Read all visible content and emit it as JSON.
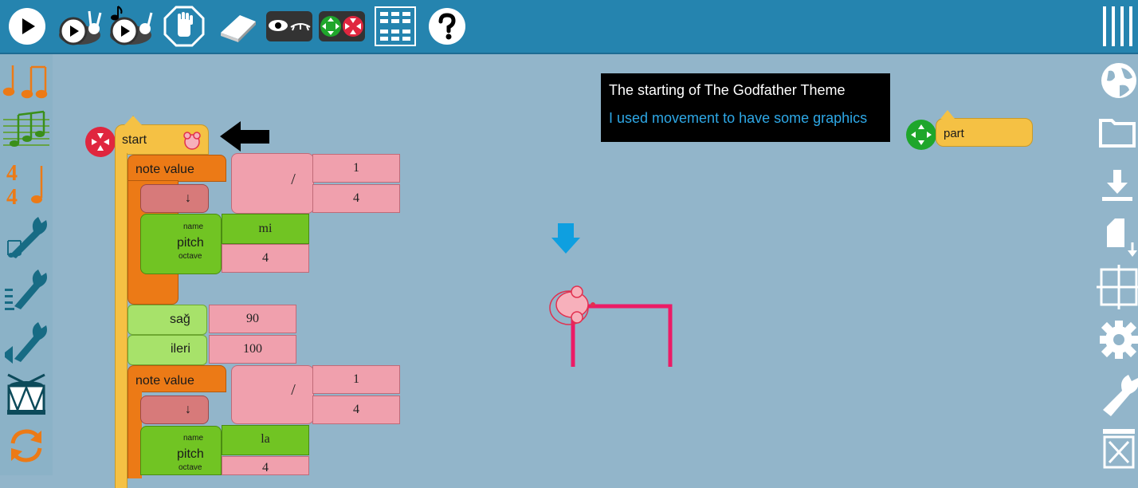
{
  "toolbar": {
    "buttons": [
      {
        "name": "play-button",
        "icon": "play-icon"
      },
      {
        "name": "play-slowly-button",
        "icon": "snail-play-icon"
      },
      {
        "name": "play-music-slowly-button",
        "icon": "snail-music-icon"
      },
      {
        "name": "stop-button",
        "icon": "hand-stop-icon"
      },
      {
        "name": "clear-button",
        "icon": "eraser-icon"
      },
      {
        "name": "hide-blocks-button",
        "icon": "eye-toggle-icon"
      },
      {
        "name": "collapse-expand-button",
        "icon": "collapse-expand-icon"
      },
      {
        "name": "grid-view-button",
        "icon": "grid-icon"
      },
      {
        "name": "help-button",
        "icon": "question-icon"
      }
    ],
    "menu_icon": "hamburger-menu-icon"
  },
  "palette": [
    "rhythm",
    "meter",
    "pitch",
    "tone",
    "ornament",
    "volume",
    "drum",
    "action"
  ],
  "right_tools": [
    "globe-icon",
    "folder-icon",
    "download-icon",
    "new-file-icon",
    "grid-toggle-icon",
    "gear-icon",
    "wrench-icon",
    "trash-icon"
  ],
  "comment": {
    "line1": "The starting of The Godfather Theme",
    "line2": "I used movement to have some graphics"
  },
  "blocks": {
    "start_label": "start",
    "part_label": "part",
    "note_value_1": {
      "label": "note value",
      "numerator": "1",
      "denominator": "4",
      "divide": "/"
    },
    "arrow_1": "↓",
    "pitch_1": {
      "name_label": "name",
      "label": "pitch",
      "octave_label": "octave",
      "name": "mi",
      "octave": "4"
    },
    "right_label": "sağ",
    "right_value": "90",
    "forward_label": "ileri",
    "forward_value": "100",
    "note_value_2": {
      "label": "note value",
      "numerator": "1",
      "denominator": "4",
      "divide": "/"
    },
    "arrow_2": "↓",
    "pitch_2": {
      "name_label": "name",
      "label": "pitch",
      "octave_label": "octave",
      "name": "la",
      "octave": "4"
    }
  },
  "colors": {
    "toolbar": "#2584af",
    "workspace": "#92b5ca",
    "start_block": "#f5c144",
    "note_value_block": "#ec7a16",
    "pitch_block": "#71c423",
    "movement_block": "#a7e26a",
    "number_block": "#f0a0ad",
    "turtle_path": "#ec1b66"
  }
}
